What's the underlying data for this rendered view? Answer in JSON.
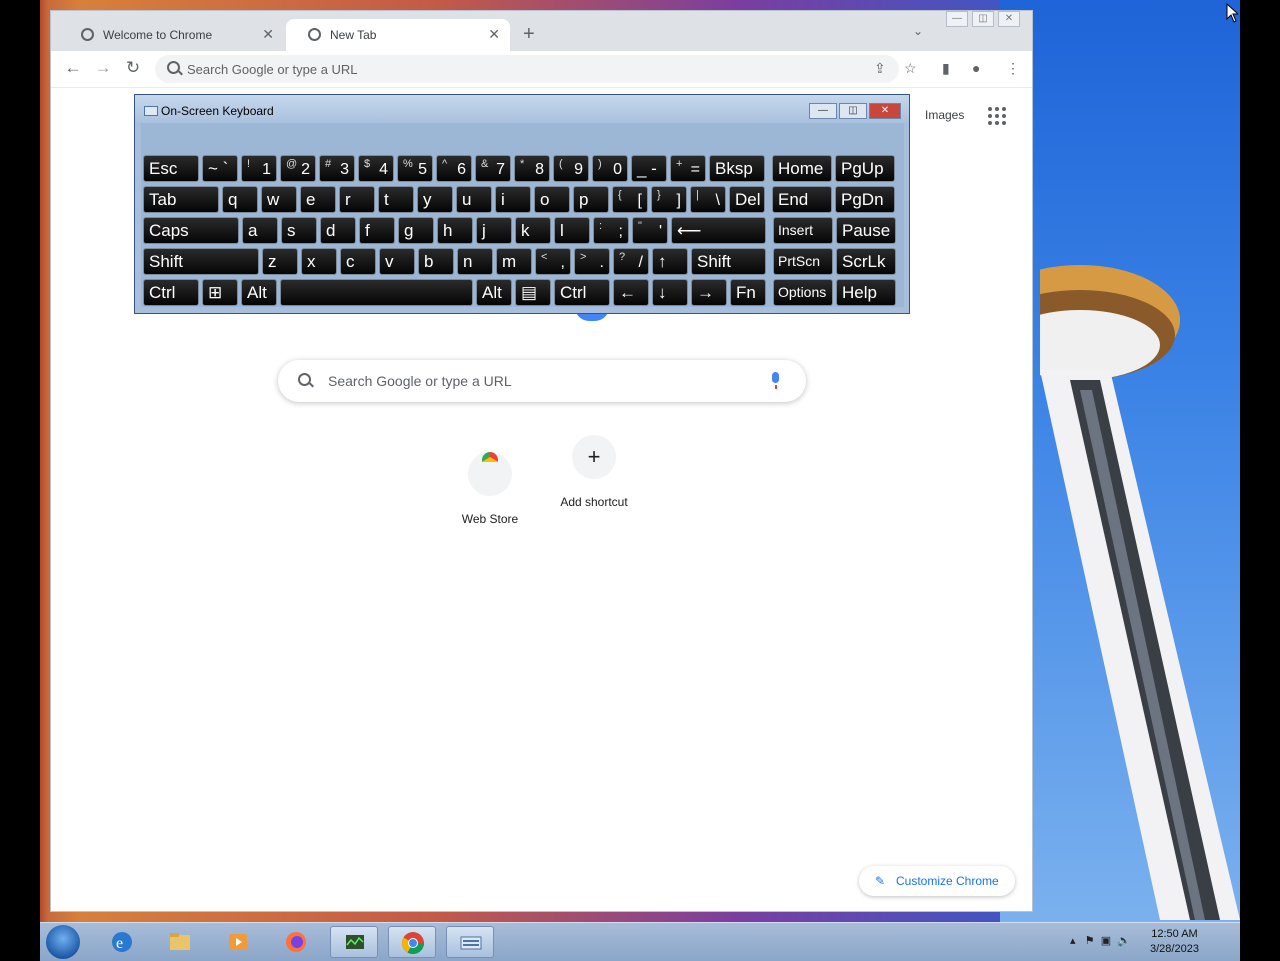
{
  "browser": {
    "tabs": [
      {
        "label": "Welcome to Chrome",
        "icon": "chrome-icon",
        "active": false
      },
      {
        "label": "New Tab",
        "icon": "chrome-icon",
        "active": true
      }
    ],
    "new_tab_label": "+",
    "omnibox_placeholder": "Search Google or type a URL",
    "window_controls": [
      "minimize",
      "restore",
      "close"
    ]
  },
  "ntp": {
    "images_link": "Images",
    "search_placeholder": "Search Google or type a URL",
    "shortcuts": [
      {
        "label": "Web Store",
        "icon": "web-store-icon"
      },
      {
        "label": "Add shortcut",
        "icon": "plus-icon"
      }
    ],
    "customize_label": "Customize Chrome"
  },
  "osk": {
    "title": "On-Screen Keyboard",
    "rows": [
      [
        [
          "Esc",
          ""
        ],
        [
          "~ `",
          ""
        ],
        [
          "!",
          "1"
        ],
        [
          "@",
          "2"
        ],
        [
          "#",
          "3"
        ],
        [
          "$",
          "4"
        ],
        [
          "%",
          "5"
        ],
        [
          "^",
          "6"
        ],
        [
          "&",
          "7"
        ],
        [
          "*",
          "8"
        ],
        [
          "(",
          "9"
        ],
        [
          ")",
          "0"
        ],
        [
          "_ -",
          ""
        ],
        [
          "+",
          "="
        ],
        [
          "Bksp",
          ""
        ],
        [
          "Home",
          ""
        ],
        [
          "PgUp",
          ""
        ]
      ],
      [
        [
          "Tab",
          ""
        ],
        [
          "q",
          ""
        ],
        [
          "w",
          ""
        ],
        [
          "e",
          ""
        ],
        [
          "r",
          ""
        ],
        [
          "t",
          ""
        ],
        [
          "y",
          ""
        ],
        [
          "u",
          ""
        ],
        [
          "i",
          ""
        ],
        [
          "o",
          ""
        ],
        [
          "p",
          ""
        ],
        [
          "{",
          "["
        ],
        [
          "}",
          "]"
        ],
        [
          "|",
          "\\"
        ],
        [
          "Del",
          ""
        ],
        [
          "End",
          ""
        ],
        [
          "PgDn",
          ""
        ]
      ],
      [
        [
          "Caps",
          ""
        ],
        [
          "a",
          ""
        ],
        [
          "s",
          ""
        ],
        [
          "d",
          ""
        ],
        [
          "f",
          ""
        ],
        [
          "g",
          ""
        ],
        [
          "h",
          ""
        ],
        [
          "j",
          ""
        ],
        [
          "k",
          ""
        ],
        [
          "l",
          ""
        ],
        [
          ":",
          ";"
        ],
        [
          "\"",
          "'"
        ],
        [
          "⟵",
          ""
        ],
        [
          "Insert",
          ""
        ],
        [
          "Pause",
          ""
        ]
      ],
      [
        [
          "Shift",
          ""
        ],
        [
          "z",
          ""
        ],
        [
          "x",
          ""
        ],
        [
          "c",
          ""
        ],
        [
          "v",
          ""
        ],
        [
          "b",
          ""
        ],
        [
          "n",
          ""
        ],
        [
          "m",
          ""
        ],
        [
          "<",
          ","
        ],
        [
          ">",
          "."
        ],
        [
          "?",
          "/"
        ],
        [
          "↑",
          ""
        ],
        [
          "Shift",
          ""
        ],
        [
          "PrtScn",
          ""
        ],
        [
          "ScrLk",
          ""
        ]
      ],
      [
        [
          "Ctrl",
          ""
        ],
        [
          "⊞",
          ""
        ],
        [
          "Alt",
          ""
        ],
        [
          "",
          ""
        ],
        [
          "Alt",
          ""
        ],
        [
          "▤",
          ""
        ],
        [
          "Ctrl",
          ""
        ],
        [
          "←",
          ""
        ],
        [
          "↓",
          ""
        ],
        [
          "→",
          ""
        ],
        [
          "Fn",
          ""
        ],
        [
          "Options",
          ""
        ],
        [
          "Help",
          ""
        ]
      ]
    ]
  },
  "taskbar": {
    "apps": [
      "internet-explorer",
      "file-explorer",
      "media-player",
      "firefox",
      "task-manager",
      "chrome",
      "on-screen-keyboard"
    ],
    "time": "12:50 AM",
    "date": "3/28/2023"
  }
}
